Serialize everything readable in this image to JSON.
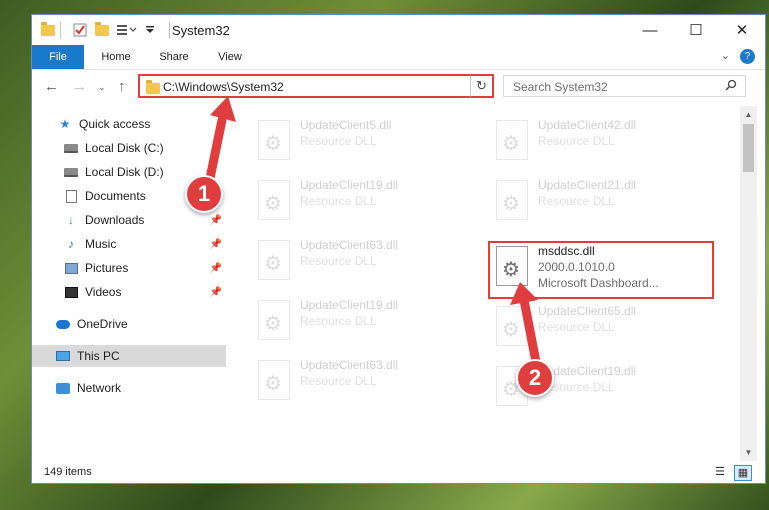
{
  "window": {
    "title": "System32",
    "controls": {
      "minimize": "—",
      "maximize": "☐",
      "close": "✕"
    }
  },
  "ribbon": {
    "tabs": [
      "File",
      "Home",
      "Share",
      "View"
    ],
    "expand_glyph": "⌄",
    "help_glyph": "?"
  },
  "address": {
    "path": "C:\\Windows\\System32",
    "search_placeholder": "Search System32"
  },
  "nav": {
    "items": [
      {
        "label": "Quick access",
        "icon": "star-icon"
      },
      {
        "label": "Local Disk (C:)",
        "icon": "drive-icon"
      },
      {
        "label": "Local Disk (D:)",
        "icon": "drive-icon"
      },
      {
        "label": "Documents",
        "icon": "documents-icon"
      },
      {
        "label": "Downloads",
        "icon": "download-icon"
      },
      {
        "label": "Music",
        "icon": "music-icon"
      },
      {
        "label": "Pictures",
        "icon": "pictures-icon"
      },
      {
        "label": "Videos",
        "icon": "videos-icon"
      },
      {
        "label": "OneDrive",
        "icon": "onedrive-icon"
      },
      {
        "label": "This PC",
        "icon": "pc-icon",
        "selected": true
      },
      {
        "label": "Network",
        "icon": "network-icon"
      }
    ]
  },
  "files": [
    {
      "name": "UpdateClient5.dll",
      "type": "Resource DLL"
    },
    {
      "name": "UpdateClient42.dll",
      "type": "Resource DLL"
    },
    {
      "name": "UpdateClient19.dll",
      "type": "Resource DLL"
    },
    {
      "name": "UpdateClient21.dll",
      "type": "Resource DLL"
    },
    {
      "name": "UpdateClient63.dll",
      "type": "Resource DLL"
    },
    {
      "name": "msddsc.dll",
      "version": "2000.0.1010.0",
      "description": "Microsoft Dashboard...",
      "highlighted": true
    },
    {
      "name": "UpdateClient19.dll",
      "type": "Resource DLL"
    },
    {
      "name": "UpdateClient65.dll",
      "type": "Resource DLL"
    },
    {
      "name": "UpdateClient63.dll",
      "type": "Resource DLL"
    },
    {
      "name": "UpdateClient19.dll",
      "type": "Resource DLL"
    }
  ],
  "status": {
    "item_count": "149 items"
  },
  "annotations": [
    "1",
    "2"
  ],
  "colors": {
    "accent": "#1979ca",
    "annotation": "#e03e3e"
  }
}
